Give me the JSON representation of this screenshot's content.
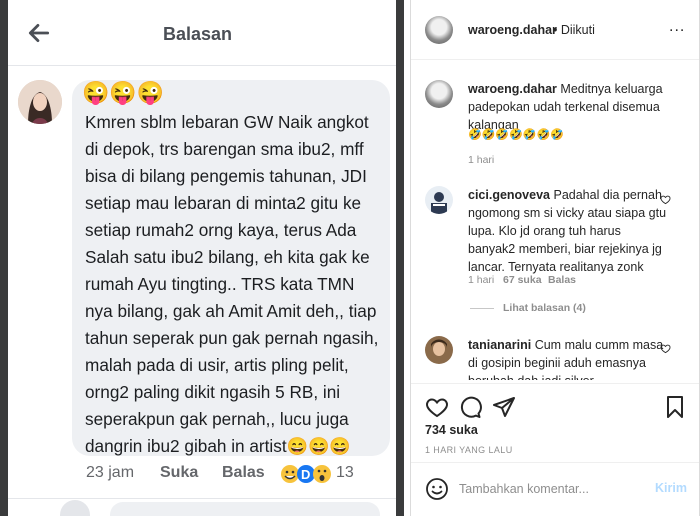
{
  "left_panel": {
    "header_title": "Balasan",
    "comment": {
      "emoji": "😜😜😜",
      "text": "Kmren sblm lebaran GW Naik angkot di depok, trs barengan sma ibu2, mff bisa di bilang pengemis tahunan, JDI setiap mau lebaran di minta2 gitu ke setiap rumah2 orng kaya,  terus Ada Salah satu ibu2 bilang,  eh kita gak ke rumah Ayu tingting..  TRS kata TMN nya bilang, gak ah Amit Amit deh,, tiap tahun seperak pun gak pernah ngasih, malah pada di usir, artis pling pelit, orng2 paling dikit ngasih 5 RB,  ini seperakpun gak pernah,, lucu juga dangrin ibu2 gibah in artist😄😄😄",
      "time": "23 jam",
      "like_label": "Suka",
      "reply_label": "Balas",
      "reaction_count": "13"
    }
  },
  "right_panel": {
    "header": {
      "username": "waroeng.dahar",
      "follow_status": "• Diikuti",
      "more": "..."
    },
    "caption": {
      "username": "waroeng.dahar",
      "text": "Meditnya keluarga padepokan udah terkenal disemua kalangan",
      "emoji": "🤣🤣🤣🤣🤣🤣🤣",
      "time": "1 hari"
    },
    "comments": [
      {
        "username": "cici.genoveva",
        "text": "Padahal dia pernah ngomong sm si vicky atau siapa gtu lupa. Klo jd orang tuh harus banyak2 memberi, biar rejekinya jg lancar. Ternyata realitanya zonk",
        "time": "1 hari",
        "likes": "67 suka",
        "reply": "Balas",
        "view_replies": "Lihat balasan (4)"
      },
      {
        "username": "tanianarini",
        "text": "Cum malu cumm masa di gosipin beginii aduh emasnya berubah dah jadi silver"
      }
    ],
    "likes_count": "734 suka",
    "date": "1 HARI YANG LALU",
    "comment_input": {
      "placeholder": "Tambahkan komentar...",
      "post_label": "Kirim"
    }
  },
  "colors": {
    "bubble_bg": "#eef0f3",
    "instagram_link_blue": "#b3dbff",
    "dark_side": "#3a3b3c"
  }
}
